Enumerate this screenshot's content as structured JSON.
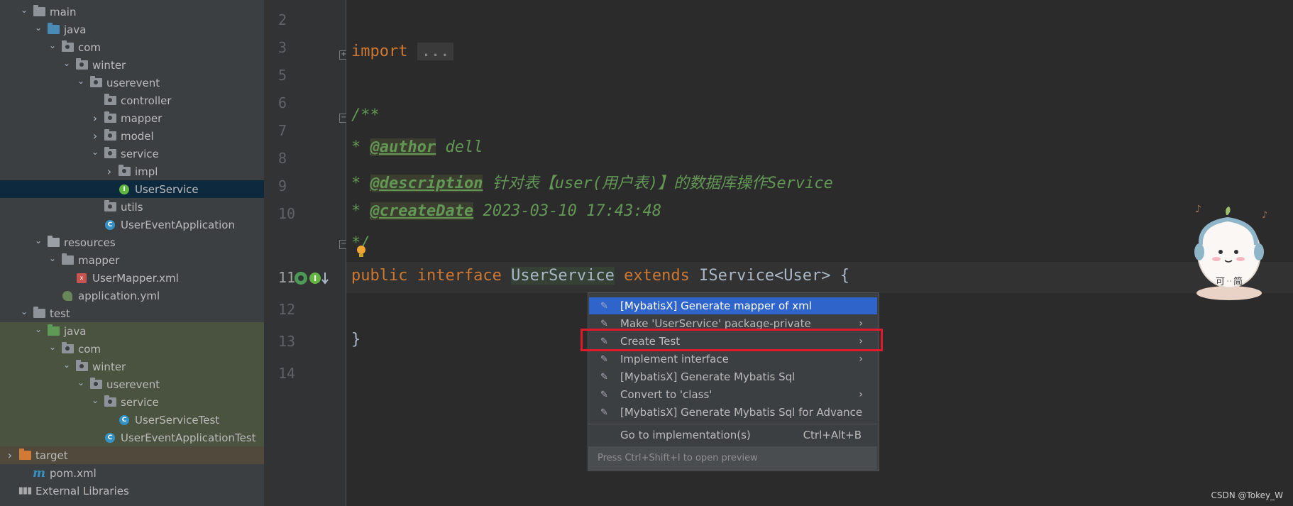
{
  "tree": {
    "rows": [
      {
        "label": "main",
        "indent": 1,
        "arrow": "down",
        "icon": "folder-grey"
      },
      {
        "label": "java",
        "indent": 2,
        "arrow": "down",
        "icon": "folder-blue"
      },
      {
        "label": "com",
        "indent": 3,
        "arrow": "down",
        "icon": "package"
      },
      {
        "label": "winter",
        "indent": 4,
        "arrow": "down",
        "icon": "package"
      },
      {
        "label": "userevent",
        "indent": 5,
        "arrow": "down",
        "icon": "package"
      },
      {
        "label": "controller",
        "indent": 6,
        "arrow": "none",
        "icon": "package"
      },
      {
        "label": "mapper",
        "indent": 6,
        "arrow": "right",
        "icon": "package"
      },
      {
        "label": "model",
        "indent": 6,
        "arrow": "right",
        "icon": "package"
      },
      {
        "label": "service",
        "indent": 6,
        "arrow": "down",
        "icon": "package"
      },
      {
        "label": "impl",
        "indent": 7,
        "arrow": "right",
        "icon": "package"
      },
      {
        "label": "UserService",
        "indent": 7,
        "arrow": "none",
        "icon": "interface",
        "selected": true
      },
      {
        "label": "utils",
        "indent": 6,
        "arrow": "none",
        "icon": "package"
      },
      {
        "label": "UserEventApplication",
        "indent": 6,
        "arrow": "none",
        "icon": "spring-class"
      },
      {
        "label": "resources",
        "indent": 2,
        "arrow": "down",
        "icon": "folder-res"
      },
      {
        "label": "mapper",
        "indent": 3,
        "arrow": "down",
        "icon": "folder-grey"
      },
      {
        "label": "UserMapper.xml",
        "indent": 4,
        "arrow": "none",
        "icon": "xml"
      },
      {
        "label": "application.yml",
        "indent": 3,
        "arrow": "none",
        "icon": "yml"
      },
      {
        "label": "test",
        "indent": 1,
        "arrow": "down",
        "icon": "folder-grey"
      },
      {
        "label": "java",
        "indent": 2,
        "arrow": "down",
        "icon": "folder-green",
        "bg": "green"
      },
      {
        "label": "com",
        "indent": 3,
        "arrow": "down",
        "icon": "package",
        "bg": "green"
      },
      {
        "label": "winter",
        "indent": 4,
        "arrow": "down",
        "icon": "package",
        "bg": "green"
      },
      {
        "label": "userevent",
        "indent": 5,
        "arrow": "down",
        "icon": "package",
        "bg": "green"
      },
      {
        "label": "service",
        "indent": 6,
        "arrow": "down",
        "icon": "package",
        "bg": "green"
      },
      {
        "label": "UserServiceTest",
        "indent": 7,
        "arrow": "none",
        "icon": "class",
        "bg": "green"
      },
      {
        "label": "UserEventApplicationTest",
        "indent": 6,
        "arrow": "none",
        "icon": "class",
        "bg": "green"
      },
      {
        "label": "target",
        "indent": 0,
        "arrow": "right",
        "icon": "folder-orange",
        "bg": "brown"
      },
      {
        "label": "pom.xml",
        "indent": 1,
        "arrow": "none",
        "icon": "maven"
      },
      {
        "label": "External Libraries",
        "indent": 0,
        "arrow": "none",
        "icon": "libraries"
      }
    ]
  },
  "editor": {
    "line_numbers": [
      "2",
      "3",
      "5",
      "6",
      "7",
      "8",
      "9",
      "10",
      "11",
      "12",
      "13",
      "14"
    ],
    "code": {
      "l3_kw": "import",
      "l3_fold": "...",
      "l6": "/**",
      "l7_star": "* ",
      "l7_tag": "@author",
      "l7_text": " dell",
      "l8_star": "* ",
      "l8_tag": "@description",
      "l8_text": " 针对表【user(用户表)】的数据库操作Service",
      "l9_star": "* ",
      "l9_tag": "@createDate",
      "l9_text": " 2023-03-10 17:43:48",
      "l10": "*/",
      "l11_kw1": "public interface ",
      "l11_name": "UserService",
      "l11_kw2": " extends ",
      "l11_rest": "IService<User> {",
      "l13": "}"
    }
  },
  "popup": {
    "items": [
      {
        "label": "[MybatisX] Generate mapper of xml",
        "submenu": false,
        "selected": true
      },
      {
        "label": "Make 'UserService' package-private",
        "submenu": true
      },
      {
        "label": "Create Test",
        "submenu": true
      },
      {
        "label": "Implement interface",
        "submenu": true
      },
      {
        "label": "[MybatisX] Generate Mybatis Sql",
        "submenu": false
      },
      {
        "label": "Convert to 'class'",
        "submenu": true
      },
      {
        "label": "[MybatisX] Generate Mybatis Sql for Advance",
        "submenu": false
      }
    ],
    "goto_label": "Go to implementation(s)",
    "goto_shortcut": "Ctrl+Alt+B",
    "footer": "Press Ctrl+Shift+I to open preview"
  },
  "sticker_text": "可ᆢ简",
  "watermark": "CSDN @Tokey_W",
  "colors": {
    "keyword": "#cc7832",
    "comment": "#629755",
    "selection": "#2f65ca",
    "highlight_box": "#e0192b"
  }
}
